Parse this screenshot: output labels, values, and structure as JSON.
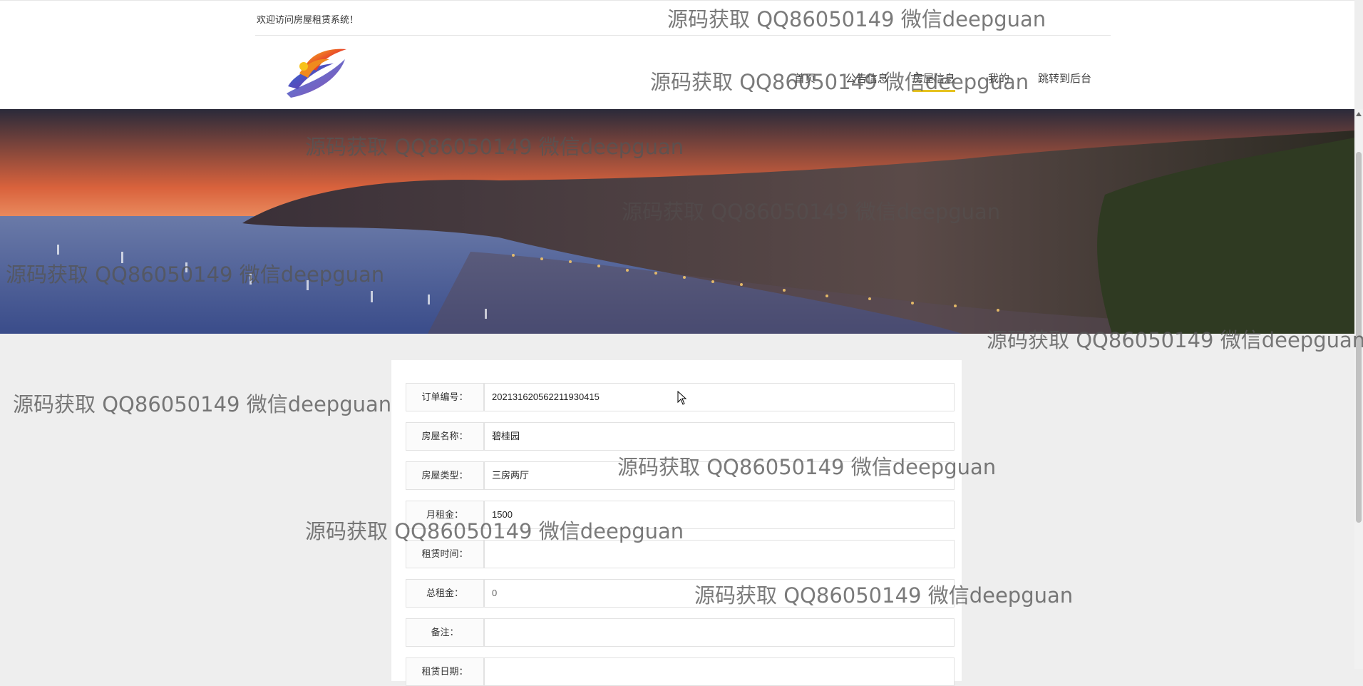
{
  "header": {
    "welcome": "欢迎访问房屋租赁系统！",
    "nav": [
      {
        "label": "首页",
        "active": false
      },
      {
        "label": "公告信息",
        "active": false
      },
      {
        "label": "房屋信息",
        "active": true
      },
      {
        "label": "我的",
        "active": false
      },
      {
        "label": "跳转到后台",
        "active": false
      }
    ]
  },
  "form": {
    "fields": [
      {
        "label": "订单编号：",
        "value": "202131620562211930415"
      },
      {
        "label": "房屋名称：",
        "value": "碧桂园"
      },
      {
        "label": "房屋类型：",
        "value": "三房两厅"
      },
      {
        "label": "月租金：",
        "value": "1500"
      },
      {
        "label": "租赁时间：",
        "value": ""
      },
      {
        "label": "总租金：",
        "value": "0"
      },
      {
        "label": "备注：",
        "value": ""
      },
      {
        "label": "租赁日期：",
        "value": ""
      }
    ]
  },
  "watermark": {
    "text": "源码获取 QQ86050149 微信deepguan"
  },
  "colors": {
    "active_nav_underline": "#e6c21f",
    "page_background": "#eeeeee"
  }
}
